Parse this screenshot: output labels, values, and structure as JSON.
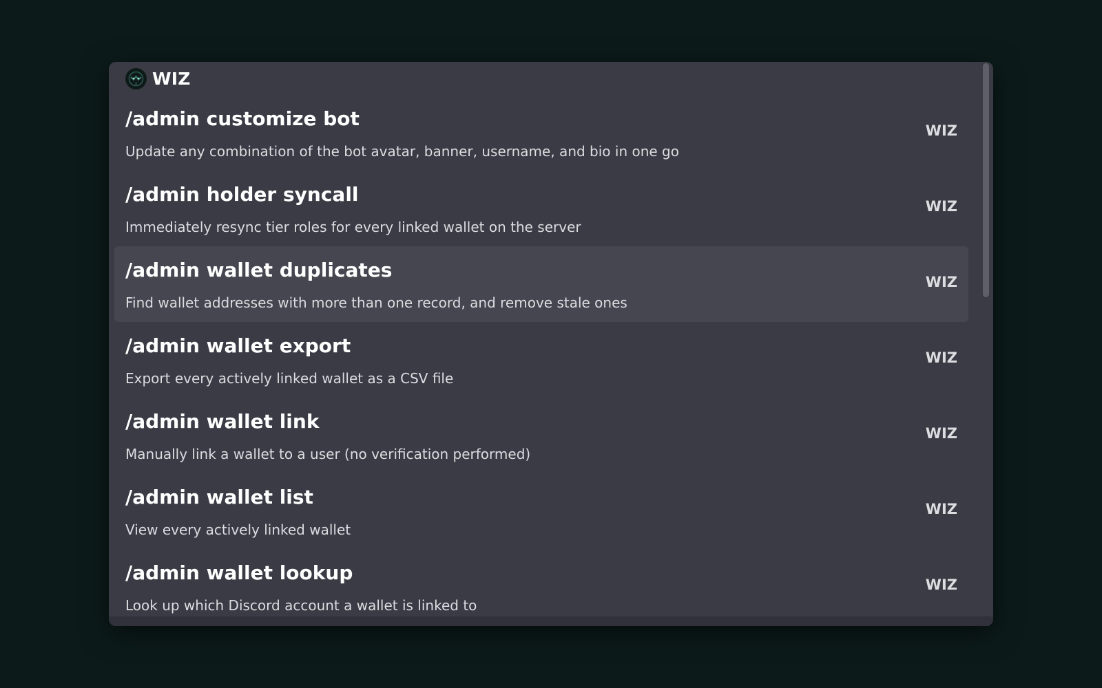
{
  "header": {
    "title": "WIZ",
    "avatar_icon": "bot-avatar-icon"
  },
  "commands": [
    {
      "name": "/admin customize bot",
      "description": "Update any combination of the bot avatar, banner, username, and bio in one go",
      "source": "WIZ"
    },
    {
      "name": "/admin holder syncall",
      "description": "Immediately resync tier roles for every linked wallet on the server",
      "source": "WIZ"
    },
    {
      "name": "/admin wallet duplicates",
      "description": "Find wallet addresses with more than one record, and remove stale ones",
      "source": "WIZ"
    },
    {
      "name": "/admin wallet export",
      "description": "Export every actively linked wallet as a CSV file",
      "source": "WIZ"
    },
    {
      "name": "/admin wallet link",
      "description": "Manually link a wallet to a user (no verification performed)",
      "source": "WIZ"
    },
    {
      "name": "/admin wallet list",
      "description": "View every actively linked wallet",
      "source": "WIZ"
    },
    {
      "name": "/admin wallet lookup",
      "description": "Look up which Discord account a wallet is linked to",
      "source": "WIZ"
    }
  ],
  "selected_index": 2,
  "colors": {
    "background": "#0c1b1a",
    "panel": "#3a3b44",
    "selected_row": "#45464f",
    "text_primary": "#ffffff",
    "text_secondary": "#dcdde1"
  }
}
